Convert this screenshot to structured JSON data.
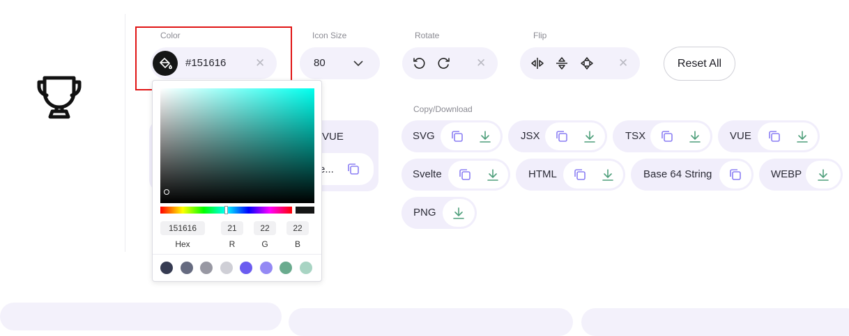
{
  "controls": {
    "color": {
      "label": "Color",
      "value": "#151616"
    },
    "icon_size": {
      "label": "Icon Size",
      "value": "80"
    },
    "rotate": {
      "label": "Rotate"
    },
    "flip": {
      "label": "Flip"
    },
    "reset_label": "Reset All"
  },
  "behind_panel": {
    "vue_label": "VUE",
    "truncated_text": "e..."
  },
  "copy_download": {
    "label": "Copy/Download",
    "formats": [
      {
        "name": "SVG"
      },
      {
        "name": "JSX"
      },
      {
        "name": "TSX"
      },
      {
        "name": "VUE"
      },
      {
        "name": "Svelte"
      },
      {
        "name": "HTML"
      },
      {
        "name": "Base 64 String"
      },
      {
        "name": "WEBP"
      },
      {
        "name": "PNG"
      }
    ]
  },
  "picker": {
    "hex": "151616",
    "r": "21",
    "g": "22",
    "b": "22",
    "labels": {
      "hex": "Hex",
      "r": "R",
      "g": "G",
      "b": "B"
    },
    "swatches": [
      "#363b52",
      "#666b80",
      "#9898a3",
      "#cfcfd6",
      "#6b5cf0",
      "#9489f4",
      "#6aab8e",
      "#a8d4c3"
    ]
  },
  "icons": {
    "preview": "trophy-icon",
    "color_chip": "paint-bucket-icon",
    "copy": "copy-icon",
    "download": "download-icon"
  },
  "colors": {
    "accent": "#6b5cf0",
    "highlight_border": "#e01414",
    "chip_bg": "#f1eefb",
    "download_green": "#4d9e7a"
  }
}
